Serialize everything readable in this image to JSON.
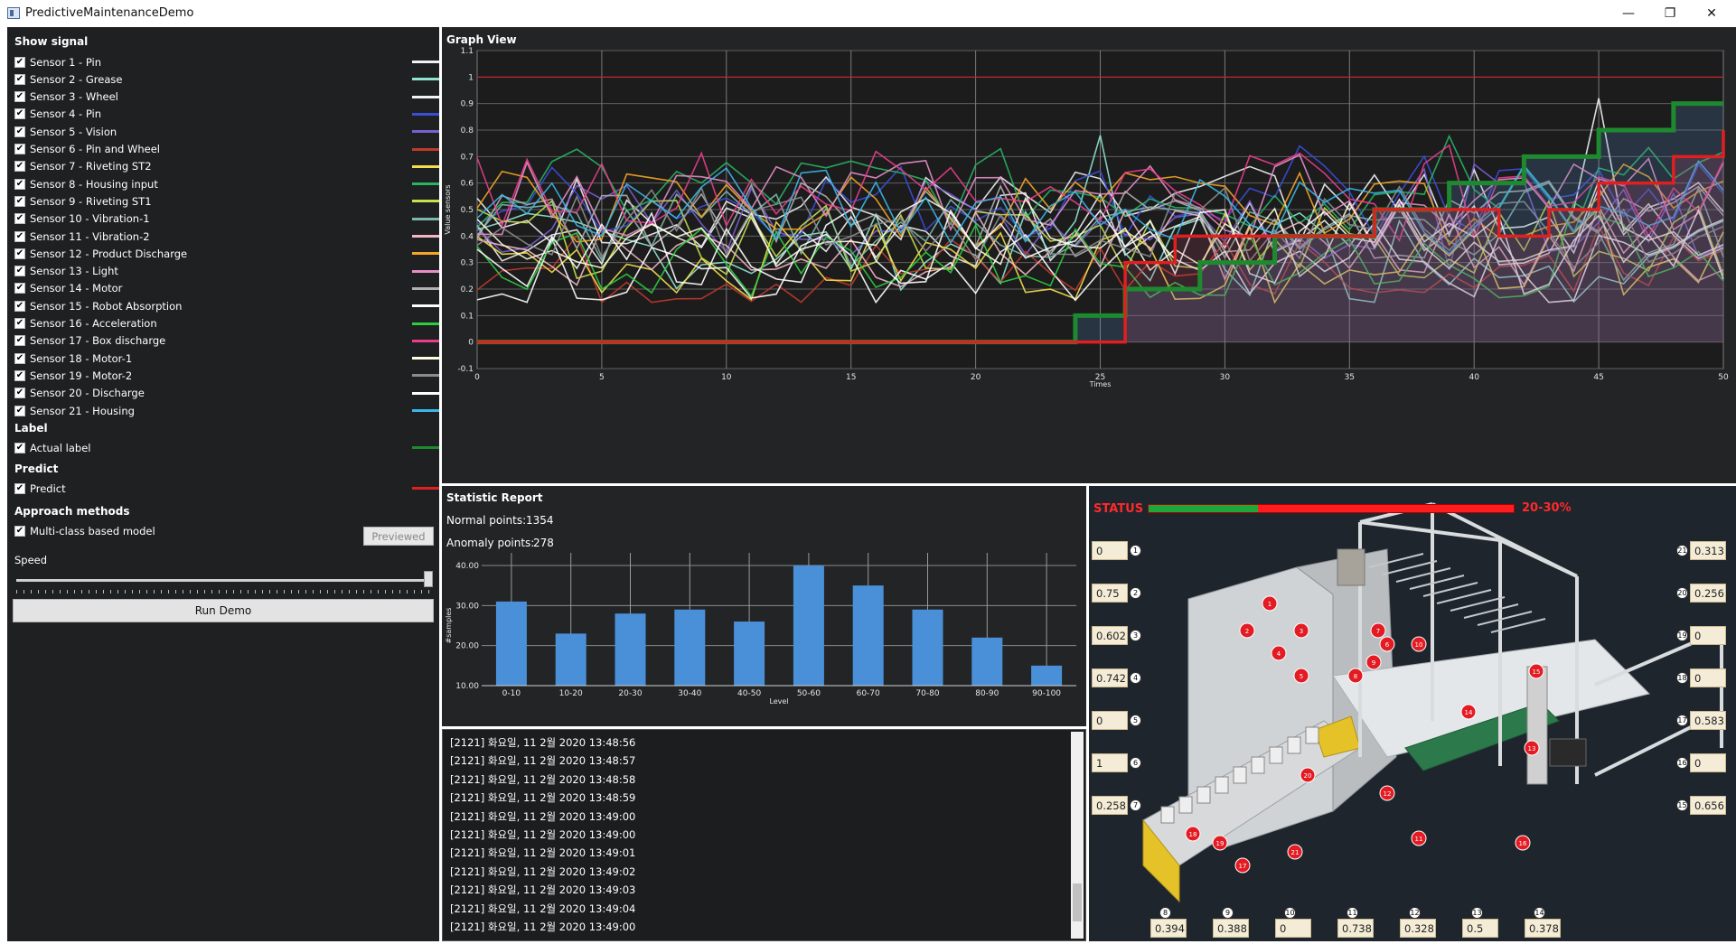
{
  "window": {
    "title": "PredictiveMaintenanceDemo",
    "minimize": "—",
    "restore": "❐",
    "close": "✕"
  },
  "left": {
    "show_signal_title": "Show signal",
    "sensors": [
      {
        "label": "Sensor 1 - Pin",
        "color": "#f2f2f2"
      },
      {
        "label": "Sensor 2 - Grease",
        "color": "#8fe3d0"
      },
      {
        "label": "Sensor 3 - Wheel",
        "color": "#f2f2f2"
      },
      {
        "label": "Sensor 4 - Pin",
        "color": "#3a4fd8"
      },
      {
        "label": "Sensor 5 - Vision",
        "color": "#7a5fd0"
      },
      {
        "label": "Sensor 6 - Pin and Wheel",
        "color": "#c0392b"
      },
      {
        "label": "Sensor 7 - Riveting ST2",
        "color": "#f4e04d"
      },
      {
        "label": "Sensor 8 - Housing input",
        "color": "#28b463"
      },
      {
        "label": "Sensor 9 - Riveting ST1",
        "color": "#c8e04d"
      },
      {
        "label": "Sensor 10 - Vibration-1",
        "color": "#7fb8a8"
      },
      {
        "label": "Sensor 11 - Vibration-2",
        "color": "#f4b6c2"
      },
      {
        "label": "Sensor 12 - Product Discharge",
        "color": "#f5a623"
      },
      {
        "label": "Sensor 13 - Light",
        "color": "#e68fc6"
      },
      {
        "label": "Sensor 14 - Motor",
        "color": "#b0b0b0"
      },
      {
        "label": "Sensor 15 - Robot Absorption",
        "color": "#ffffff"
      },
      {
        "label": "Sensor 16 - Acceleration",
        "color": "#2ecc40"
      },
      {
        "label": "Sensor 17 - Box discharge",
        "color": "#e83e8c"
      },
      {
        "label": "Sensor 18 - Motor-1",
        "color": "#fffde0"
      },
      {
        "label": "Sensor 19 - Motor-2",
        "color": "#8c8c8c"
      },
      {
        "label": "Sensor 20 - Discharge",
        "color": "#ffffff"
      },
      {
        "label": "Sensor 21 - Housing",
        "color": "#3ab7e8"
      }
    ],
    "label_title": "Label",
    "actual_label": {
      "label": "Actual label",
      "color": "#1e8a30"
    },
    "predict_title": "Predict",
    "predict": {
      "label": "Predict",
      "color": "#e02020"
    },
    "approach_title": "Approach methods",
    "approach": {
      "label": "Multi-class based model"
    },
    "previewed_label": "Previewed",
    "speed_label": "Speed",
    "run_label": "Run Demo",
    "check_mark": "✔"
  },
  "graph": {
    "title": "Graph View",
    "ylabel": "Value sensors",
    "xlabel": "Times"
  },
  "stats": {
    "title": "Statistic Report",
    "normal_label": "Normal points:",
    "normal_value": "1354",
    "anomaly_label": "Anomaly points:",
    "anomaly_value": "278"
  },
  "log": {
    "lines": [
      "[2121] 화요일, 11 2월 2020 13:48:56",
      "[2121] 화요일, 11 2월 2020 13:48:57",
      "[2121] 화요일, 11 2월 2020 13:48:58",
      "[2121] 화요일, 11 2월 2020 13:48:59",
      "[2121] 화요일, 11 2월 2020 13:49:00",
      "[2121] 화요일, 11 2월 2020 13:49:00",
      "[2121] 화요일, 11 2월 2020 13:49:01",
      "[2121] 화요일, 11 2월 2020 13:49:02",
      "[2121] 화요일, 11 2월 2020 13:49:03",
      "[2121] 화요일, 11 2월 2020 13:49:04",
      "[2121] 화요일, 11 2월 2020 13:49:00"
    ]
  },
  "factory": {
    "status_label": "STATUS",
    "status_value": "20-30%",
    "status_fraction": 0.3,
    "left_values": [
      {
        "num": "1",
        "value": "0"
      },
      {
        "num": "2",
        "value": "0.75"
      },
      {
        "num": "3",
        "value": "0.602"
      },
      {
        "num": "4",
        "value": "0.742"
      },
      {
        "num": "5",
        "value": "0"
      },
      {
        "num": "6",
        "value": "1"
      },
      {
        "num": "7",
        "value": "0.258"
      }
    ],
    "right_values": [
      {
        "num": "21",
        "value": "0.313"
      },
      {
        "num": "20",
        "value": "0.256"
      },
      {
        "num": "19",
        "value": "0"
      },
      {
        "num": "18",
        "value": "0"
      },
      {
        "num": "17",
        "value": "0.583"
      },
      {
        "num": "16",
        "value": "0"
      },
      {
        "num": "15",
        "value": "0.656"
      }
    ],
    "bottom_values": [
      {
        "num": "8",
        "value": "0.394"
      },
      {
        "num": "9",
        "value": "0.388"
      },
      {
        "num": "10",
        "value": "0"
      },
      {
        "num": "11",
        "value": "0.738"
      },
      {
        "num": "12",
        "value": "0.328"
      },
      {
        "num": "13",
        "value": "0.5"
      },
      {
        "num": "14",
        "value": "0.378"
      }
    ],
    "markers": [
      "1",
      "2",
      "3",
      "4",
      "5",
      "6",
      "7",
      "8",
      "9",
      "10",
      "11",
      "12",
      "13",
      "14",
      "15",
      "16",
      "17",
      "18",
      "19",
      "20",
      "21"
    ]
  },
  "chart_data": [
    {
      "type": "line",
      "title": "Graph View",
      "xlabel": "Times",
      "ylabel": "Value sensors",
      "xlim": [
        0,
        50
      ],
      "ylim": [
        -0.1,
        1.1
      ],
      "x_ticks": [
        "0",
        "5",
        "10",
        "15",
        "20",
        "25",
        "30",
        "35",
        "40",
        "45",
        "50"
      ],
      "y_ticks": [
        "-0.1",
        "0",
        "0.1",
        "0.2",
        "0.3",
        "0.4",
        "0.5",
        "0.6",
        "0.7",
        "0.8",
        "0.9",
        "1",
        "1.1"
      ],
      "threshold": 1.0,
      "grid": true,
      "series": [
        {
          "name": "Actual label",
          "color": "#1e8a30",
          "values": [
            0,
            0,
            0,
            0,
            0,
            0,
            0,
            0,
            0,
            0,
            0,
            0,
            0,
            0,
            0,
            0,
            0,
            0,
            0,
            0,
            0,
            0,
            0,
            0,
            0.1,
            0.1,
            0.2,
            0.2,
            0.2,
            0.3,
            0.3,
            0.3,
            0.4,
            0.4,
            0.4,
            0.4,
            0.5,
            0.5,
            0.5,
            0.6,
            0.6,
            0.6,
            0.7,
            0.7,
            0.7,
            0.8,
            0.8,
            0.8,
            0.9,
            0.9,
            0.9
          ]
        },
        {
          "name": "Predict",
          "color": "#e02020",
          "values": [
            0,
            0,
            0,
            0,
            0,
            0,
            0,
            0,
            0,
            0,
            0,
            0,
            0,
            0,
            0,
            0,
            0,
            0,
            0,
            0,
            0,
            0,
            0,
            0,
            0,
            0,
            0.3,
            0.3,
            0.4,
            0.4,
            0.4,
            0.4,
            0.4,
            0.4,
            0.4,
            0.4,
            0.5,
            0.5,
            0.5,
            0.5,
            0.5,
            0.4,
            0.4,
            0.5,
            0.5,
            0.6,
            0.6,
            0.6,
            0.7,
            0.7,
            0.8
          ]
        }
      ]
    },
    {
      "type": "bar",
      "title": "Statistic Report",
      "xlabel": "Level",
      "ylabel": "#samples",
      "categories": [
        "0-10",
        "10-20",
        "20-30",
        "30-40",
        "40-50",
        "50-60",
        "60-70",
        "70-80",
        "80-90",
        "90-100"
      ],
      "values": [
        31,
        23,
        28,
        29,
        26,
        40,
        35,
        29,
        22,
        15
      ],
      "ylim": [
        10,
        40
      ],
      "y_ticks": [
        "10.00",
        "20.00",
        "30.00",
        "40.00"
      ],
      "color": "#4a90d9"
    }
  ]
}
